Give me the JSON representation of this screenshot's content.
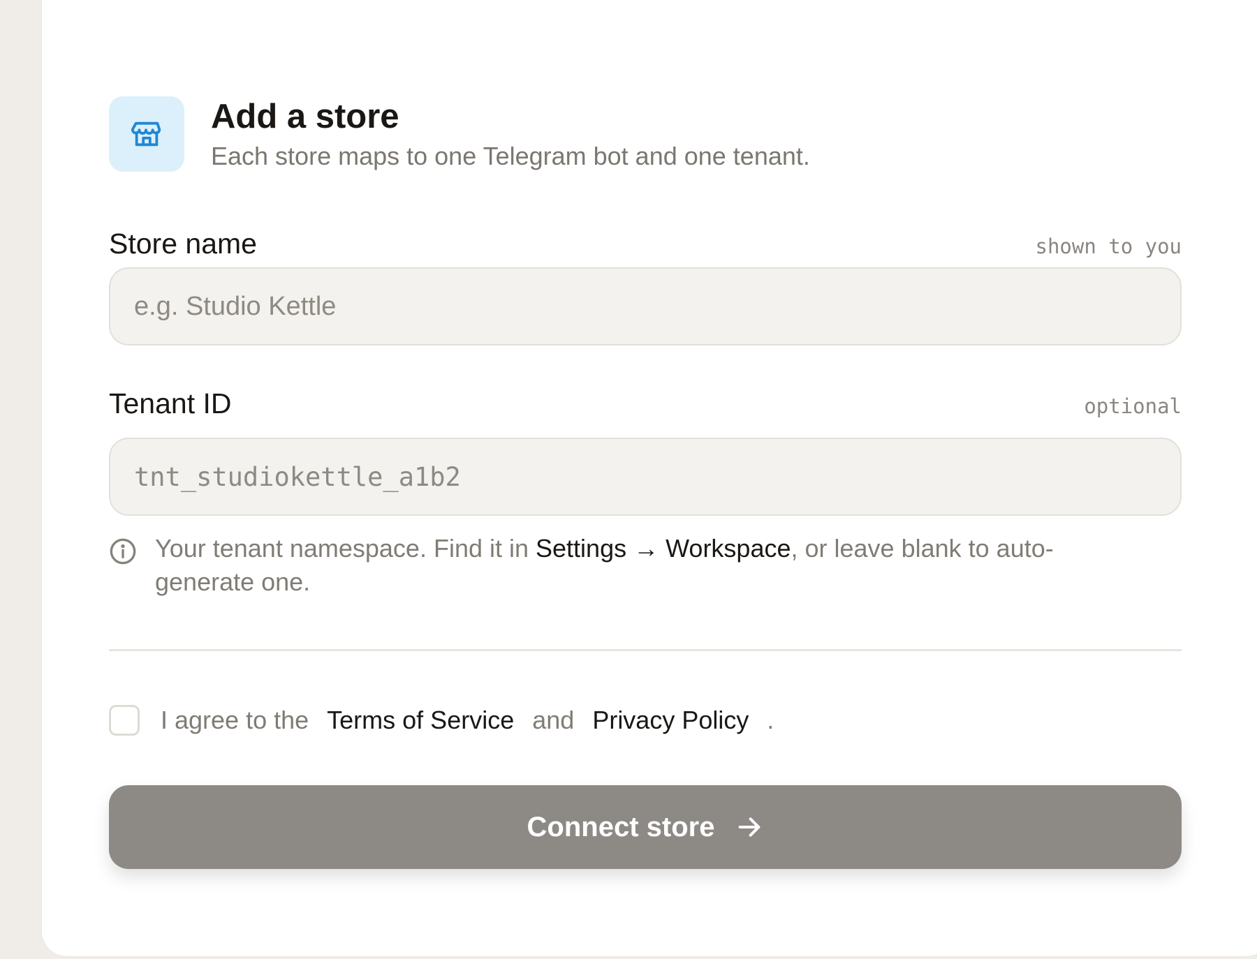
{
  "header": {
    "title": "Add a store",
    "subtitle": "Each store maps to one Telegram bot and one tenant.",
    "icon": "storefront-icon",
    "accent": "#1e88d6"
  },
  "fields": {
    "store_name": {
      "label": "Store name",
      "hint": "shown to you",
      "value": "",
      "placeholder": "e.g. Studio Kettle"
    },
    "tenant_id": {
      "label": "Tenant ID",
      "hint": "optional",
      "value": "",
      "placeholder": "tnt_studiokettle_a1b2",
      "help_before": "Your tenant namespace. Find it in ",
      "help_strong": "Settings → Workspace",
      "help_after": ", or leave blank to auto-generate one."
    }
  },
  "agreement": {
    "checked": false,
    "prefix": "I agree to the",
    "terms_link": "Terms of Service",
    "joiner": "and",
    "privacy_link": "Privacy Policy",
    "suffix": "."
  },
  "submit": {
    "label": "Connect store",
    "icon": "arrow-right-icon"
  },
  "colors": {
    "card_background": "#ffffff",
    "page_background": "#f0ede8",
    "button_disabled": "#8d8a86"
  }
}
